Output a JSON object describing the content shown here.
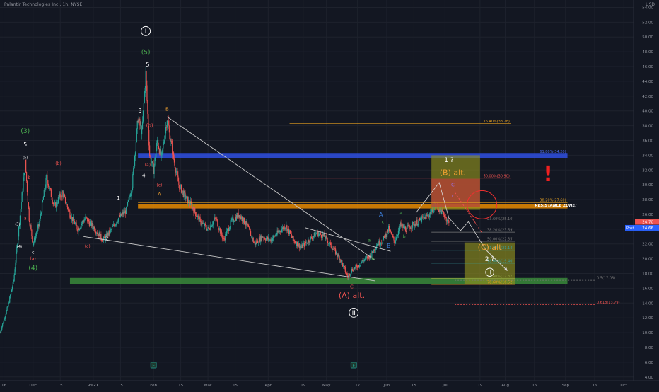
{
  "header": {
    "title": "Palantir Technologies Inc., 1h, NYSE",
    "currency": "USD"
  },
  "colors": {
    "background": "#131722",
    "grid": "#1e222d",
    "up": "#26a69a",
    "down": "#ef5350",
    "blue_zone": "#2f4fe0",
    "orange_zone": "#e68a00",
    "green_zone": "#3a8a3a",
    "yellow_box": "#8f8f1e",
    "red_box": "#c43a3a"
  },
  "chart_data": {
    "type": "candlestick",
    "ylim": [
      3.5,
      55
    ],
    "y_ticks": [
      4,
      6,
      8,
      10,
      12,
      14,
      16,
      18,
      20,
      22,
      24,
      26,
      28,
      30,
      32,
      34,
      36,
      38,
      40,
      42,
      44,
      46,
      48,
      50,
      52,
      54
    ],
    "y_tick_labels": [
      "4.00",
      "6.00",
      "8.00",
      "10.00",
      "12.00",
      "14.00",
      "16.00",
      "18.00",
      "20.00",
      "22.00",
      "24.00",
      "26.00",
      "28.00",
      "30.00",
      "32.00",
      "34.00",
      "36.00",
      "38.00",
      "40.00",
      "42.00",
      "44.00",
      "46.00",
      "48.00",
      "50.00",
      "52.00",
      "54.00"
    ],
    "x_ticks": [
      {
        "label": "16",
        "date": "2020-11-16"
      },
      {
        "label": "Dec",
        "date": "2020-12-01"
      },
      {
        "label": "15",
        "date": "2020-12-15"
      },
      {
        "label": "2021",
        "date": "2021-01-01"
      },
      {
        "label": "15",
        "date": "2021-01-15"
      },
      {
        "label": "Feb",
        "date": "2021-02-01"
      },
      {
        "label": "15",
        "date": "2021-02-15"
      },
      {
        "label": "Mar",
        "date": "2021-03-01"
      },
      {
        "label": "15",
        "date": "2021-03-15"
      },
      {
        "label": "Apr",
        "date": "2021-04-01"
      },
      {
        "label": "19",
        "date": "2021-04-19"
      },
      {
        "label": "May",
        "date": "2021-05-01"
      },
      {
        "label": "17",
        "date": "2021-05-17"
      },
      {
        "label": "Jun",
        "date": "2021-06-01"
      },
      {
        "label": "15",
        "date": "2021-06-15"
      },
      {
        "label": "Jul",
        "date": "2021-07-01"
      },
      {
        "label": "19",
        "date": "2021-07-19"
      },
      {
        "label": "Aug",
        "date": "2021-08-01"
      },
      {
        "label": "16",
        "date": "2021-08-16"
      },
      {
        "label": "Sep",
        "date": "2021-09-01"
      },
      {
        "label": "16",
        "date": "2021-09-16"
      },
      {
        "label": "Oct",
        "date": "2021-10-01"
      }
    ],
    "price_path": [
      {
        "date": "2020-11-14",
        "value": 10.0
      },
      {
        "date": "2020-11-18",
        "value": 13.5
      },
      {
        "date": "2020-11-21",
        "value": 17.0
      },
      {
        "date": "2020-11-24",
        "value": 25.0
      },
      {
        "date": "2020-11-27",
        "value": 33.0
      },
      {
        "date": "2020-11-29",
        "value": 25.5
      },
      {
        "date": "2020-12-01",
        "value": 22.0
      },
      {
        "date": "2020-12-04",
        "value": 24.5
      },
      {
        "date": "2020-12-08",
        "value": 31.0
      },
      {
        "date": "2020-12-12",
        "value": 27.0
      },
      {
        "date": "2020-12-16",
        "value": 29.0
      },
      {
        "date": "2020-12-20",
        "value": 26.0
      },
      {
        "date": "2020-12-24",
        "value": 24.0
      },
      {
        "date": "2020-12-28",
        "value": 25.5
      },
      {
        "date": "2021-01-02",
        "value": 24.0
      },
      {
        "date": "2021-01-06",
        "value": 22.5
      },
      {
        "date": "2021-01-10",
        "value": 23.8
      },
      {
        "date": "2021-01-14",
        "value": 25.5
      },
      {
        "date": "2021-01-18",
        "value": 26.5
      },
      {
        "date": "2021-01-21",
        "value": 30.0
      },
      {
        "date": "2021-01-24",
        "value": 39.0
      },
      {
        "date": "2021-01-26",
        "value": 37.0
      },
      {
        "date": "2021-01-28",
        "value": 45.0
      },
      {
        "date": "2021-01-30",
        "value": 34.0
      },
      {
        "date": "2021-02-01",
        "value": 32.0
      },
      {
        "date": "2021-02-03",
        "value": 36.0
      },
      {
        "date": "2021-02-05",
        "value": 33.5
      },
      {
        "date": "2021-02-08",
        "value": 39.0
      },
      {
        "date": "2021-02-11",
        "value": 34.0
      },
      {
        "date": "2021-02-14",
        "value": 30.0
      },
      {
        "date": "2021-02-17",
        "value": 28.5
      },
      {
        "date": "2021-02-21",
        "value": 27.0
      },
      {
        "date": "2021-02-25",
        "value": 25.0
      },
      {
        "date": "2021-03-01",
        "value": 24.0
      },
      {
        "date": "2021-03-05",
        "value": 25.5
      },
      {
        "date": "2021-03-09",
        "value": 22.5
      },
      {
        "date": "2021-03-13",
        "value": 25.0
      },
      {
        "date": "2021-03-17",
        "value": 26.0
      },
      {
        "date": "2021-03-21",
        "value": 24.5
      },
      {
        "date": "2021-03-25",
        "value": 22.0
      },
      {
        "date": "2021-03-29",
        "value": 23.0
      },
      {
        "date": "2021-04-02",
        "value": 22.5
      },
      {
        "date": "2021-04-06",
        "value": 23.5
      },
      {
        "date": "2021-04-10",
        "value": 24.5
      },
      {
        "date": "2021-04-14",
        "value": 22.5
      },
      {
        "date": "2021-04-18",
        "value": 21.5
      },
      {
        "date": "2021-04-22",
        "value": 22.5
      },
      {
        "date": "2021-04-26",
        "value": 23.5
      },
      {
        "date": "2021-04-30",
        "value": 23.0
      },
      {
        "date": "2021-05-04",
        "value": 21.5
      },
      {
        "date": "2021-05-08",
        "value": 20.0
      },
      {
        "date": "2021-05-12",
        "value": 17.5
      },
      {
        "date": "2021-05-14",
        "value": 18.5
      },
      {
        "date": "2021-05-17",
        "value": 19.0
      },
      {
        "date": "2021-05-20",
        "value": 19.8
      },
      {
        "date": "2021-05-24",
        "value": 20.5
      },
      {
        "date": "2021-05-27",
        "value": 22.0
      },
      {
        "date": "2021-05-30",
        "value": 22.5
      },
      {
        "date": "2021-06-02",
        "value": 24.0
      },
      {
        "date": "2021-06-05",
        "value": 22.3
      },
      {
        "date": "2021-06-08",
        "value": 24.5
      },
      {
        "date": "2021-06-11",
        "value": 24.0
      },
      {
        "date": "2021-06-14",
        "value": 24.5
      },
      {
        "date": "2021-06-17",
        "value": 25.0
      },
      {
        "date": "2021-06-20",
        "value": 25.5
      },
      {
        "date": "2021-06-23",
        "value": 26.0
      },
      {
        "date": "2021-06-26",
        "value": 27.2
      },
      {
        "date": "2021-06-29",
        "value": 26.5
      },
      {
        "date": "2021-07-01",
        "value": 25.8
      },
      {
        "date": "2021-07-03",
        "value": 24.7
      }
    ],
    "zones": [
      {
        "name": "blue-zone",
        "y0": 33.6,
        "y1": 34.3,
        "x0": "2021-01-24",
        "x1": "2021-09-02",
        "color": "#2f4fe0"
      },
      {
        "name": "orange-zone",
        "y0": 26.8,
        "y1": 27.4,
        "x0": "2021-01-24",
        "x1": "2021-09-02",
        "color": "#e68a00"
      },
      {
        "name": "green-zone",
        "y0": 16.6,
        "y1": 17.4,
        "x0": "2020-12-20",
        "x1": "2021-09-02",
        "color": "#3a8a3a"
      }
    ],
    "boxes": [
      {
        "name": "b-alt-yellow-box",
        "x0": "2021-06-24",
        "x1": "2021-07-19",
        "y0": 26.6,
        "y1": 34.0,
        "color": "#8f8f1e"
      },
      {
        "name": "b-alt-red-box",
        "x0": "2021-06-24",
        "x1": "2021-07-19",
        "y0": 27.0,
        "y1": 30.8,
        "color": "#c43a3a"
      },
      {
        "name": "c-alt-yellow-box",
        "x0": "2021-07-11",
        "x1": "2021-08-06",
        "y0": 16.6,
        "y1": 22.2,
        "color": "#8f8f1e"
      }
    ],
    "fib_lines": [
      {
        "label": "76.40%(38.28)",
        "value": 38.28,
        "x0": "2021-04-12",
        "x1": "2021-08-04",
        "color": "#e6a020"
      },
      {
        "label": "61.80%(34.20)",
        "value": 34.2,
        "x0": "2021-01-24",
        "x1": "2021-09-02",
        "color": "#4c6cf0"
      },
      {
        "label": "50.00%(30.90)",
        "value": 30.9,
        "x0": "2021-04-12",
        "x1": "2021-08-04",
        "color": "#ef5350"
      },
      {
        "label": "38.20%(27.60)",
        "value": 27.6,
        "x0": "2021-01-24",
        "x1": "2021-09-02",
        "color": "#e6a020"
      },
      {
        "label": "23.60%(25.10)",
        "value": 25.1,
        "x0": "2021-06-24",
        "x1": "2021-08-06",
        "color": "#7a7a7a"
      },
      {
        "label": "38.20%(23.59)",
        "value": 23.59,
        "x0": "2021-06-24",
        "x1": "2021-08-06",
        "color": "#7a7a7a"
      },
      {
        "label": "50.00%(22.35)",
        "value": 22.35,
        "x0": "2021-06-24",
        "x1": "2021-08-06",
        "color": "#7a7a7a"
      },
      {
        "label": "61.80%(21.14)",
        "value": 21.14,
        "x0": "2021-06-24",
        "x1": "2021-08-06",
        "color": "#3aa0a0"
      },
      {
        "label": "78.60%(19.40)",
        "value": 19.4,
        "x0": "2021-06-24",
        "x1": "2021-08-06",
        "color": "#3aa0a0"
      },
      {
        "label": "76.40%(17.32)",
        "value": 17.32,
        "x0": "2021-06-24",
        "x1": "2021-08-06",
        "color": "#8fa040"
      },
      {
        "label": "78.60%(16.52)",
        "value": 16.52,
        "x0": "2021-06-24",
        "x1": "2021-08-06",
        "color": "#e6a020"
      },
      {
        "label": "0.5(17.08)",
        "value": 17.08,
        "x0": "2021-07-06",
        "x1": "2021-09-16",
        "color": "#7a7a7a"
      },
      {
        "label": "0.618(13.79)",
        "value": 13.79,
        "x0": "2021-07-06",
        "x1": "2021-09-16",
        "color": "#ef5350"
      }
    ],
    "trendlines": [
      {
        "name": "upper-wedge-line",
        "x0": "2021-02-08",
        "y0": 39.2,
        "x1": "2021-05-26",
        "y1": 19.8,
        "color": "#c8c8c8"
      },
      {
        "name": "lower-wedge-line",
        "x0": "2020-12-27",
        "y0": 23.0,
        "x1": "2021-05-26",
        "y1": 17.0,
        "color": "#c8c8c8"
      },
      {
        "name": "breakout-line",
        "x0": "2021-04-20",
        "y0": 24.2,
        "x1": "2021-06-03",
        "y1": 21.0,
        "color": "#c8c8c8"
      }
    ],
    "projection": [
      {
        "date": "2021-06-16",
        "value": 26.2
      },
      {
        "date": "2021-06-28",
        "value": 30.3
      },
      {
        "date": "2021-07-03",
        "value": 25.5
      },
      {
        "date": "2021-07-09",
        "value": 23.8
      },
      {
        "date": "2021-07-13",
        "value": 25.0
      },
      {
        "date": "2021-07-22",
        "value": 21.2
      },
      {
        "date": "2021-08-02",
        "value": 18.4
      }
    ],
    "red_dashed": [
      {
        "date": "2021-07-06",
        "value": 29.0
      },
      {
        "date": "2021-07-20",
        "value": 23.5
      }
    ],
    "resistance_ellipse": {
      "date": "2021-07-20",
      "value": 27.3
    },
    "wave_labels": [
      {
        "text": "I",
        "circled": true,
        "date": "2021-01-28",
        "value": 50.5,
        "color": "#ffffff",
        "size": 9
      },
      {
        "text": "(5)",
        "date": "2021-01-28",
        "value": 47.7,
        "color": "#4caf50",
        "size": 9
      },
      {
        "text": "5",
        "date": "2021-01-29",
        "value": 46.0,
        "color": "#ffffff",
        "size": 8
      },
      {
        "text": "3",
        "date": "2021-01-25",
        "value": 39.8,
        "color": "#ffffff",
        "size": 8
      },
      {
        "text": "(b)",
        "date": "2021-01-30",
        "value": 37.8,
        "color": "#ef5350",
        "size": 7
      },
      {
        "text": "B",
        "date": "2021-02-08",
        "value": 40.0,
        "color": "#f0a030",
        "size": 7
      },
      {
        "text": "(a)",
        "date": "2021-01-29",
        "value": 32.5,
        "color": "#ef5350",
        "size": 6
      },
      {
        "text": "4",
        "date": "2021-01-27",
        "value": 31.0,
        "color": "#ffffff",
        "size": 7
      },
      {
        "text": "(c)",
        "date": "2021-02-04",
        "value": 29.8,
        "color": "#ef5350",
        "size": 6
      },
      {
        "text": "A",
        "date": "2021-02-04",
        "value": 28.5,
        "color": "#f0a030",
        "size": 7
      },
      {
        "text": "1",
        "date": "2021-01-14",
        "value": 28.0,
        "color": "#ffffff",
        "size": 7
      },
      {
        "text": "2",
        "date": "2021-01-08",
        "value": 22.5,
        "color": "#ffffff",
        "size": 7
      },
      {
        "text": "(3)",
        "date": "2020-11-27",
        "value": 37.0,
        "color": "#4caf50",
        "size": 9
      },
      {
        "text": "5",
        "date": "2020-11-27",
        "value": 35.2,
        "color": "#ffffff",
        "size": 8
      },
      {
        "text": "(5)",
        "date": "2020-11-27",
        "value": 33.5,
        "color": "#ffffff",
        "size": 5
      },
      {
        "text": "(b)",
        "date": "2020-12-14",
        "value": 32.7,
        "color": "#ef5350",
        "size": 6
      },
      {
        "text": "b",
        "date": "2020-11-29",
        "value": 30.8,
        "color": "#ef5350",
        "size": 6
      },
      {
        "text": "a",
        "date": "2020-11-27",
        "value": 25.3,
        "color": "#ef5350",
        "size": 6
      },
      {
        "text": "(3)",
        "date": "2020-11-23",
        "value": 24.5,
        "color": "#ffffff",
        "size": 5
      },
      {
        "text": "(4)",
        "date": "2020-11-24",
        "value": 21.5,
        "color": "#ffffff",
        "size": 5
      },
      {
        "text": "c",
        "date": "2020-12-01",
        "value": 20.7,
        "color": "#ffffff",
        "size": 6
      },
      {
        "text": "(a)",
        "date": "2020-12-01",
        "value": 19.8,
        "color": "#ef5350",
        "size": 6
      },
      {
        "text": "(4)",
        "date": "2020-12-01",
        "value": 18.5,
        "color": "#4caf50",
        "size": 9
      },
      {
        "text": "(c)",
        "date": "2020-12-29",
        "value": 21.5,
        "color": "#ef5350",
        "size": 6
      },
      {
        "text": "A",
        "date": "2021-05-29",
        "value": 25.7,
        "color": "#3a7bd5",
        "size": 8
      },
      {
        "text": "c",
        "date": "2021-05-30",
        "value": 24.8,
        "color": "#4caf50",
        "size": 6
      },
      {
        "text": "a",
        "date": "2021-06-08",
        "value": 26.0,
        "color": "#4caf50",
        "size": 6
      },
      {
        "text": "b",
        "date": "2021-06-10",
        "value": 22.8,
        "color": "#4caf50",
        "size": 6
      },
      {
        "text": "a",
        "date": "2021-05-23",
        "value": 22.3,
        "color": "#4caf50",
        "size": 6
      },
      {
        "text": "b",
        "date": "2021-05-25",
        "value": 19.8,
        "color": "#4caf50",
        "size": 6
      },
      {
        "text": "B",
        "date": "2021-06-02",
        "value": 21.5,
        "color": "#3a7bd5",
        "size": 8
      },
      {
        "text": "C",
        "date": "2021-05-14",
        "value": 16.0,
        "color": "#ef5350",
        "size": 7
      },
      {
        "text": "(A) alt.",
        "date": "2021-05-14",
        "value": 14.7,
        "color": "#ef5350",
        "size": 11
      },
      {
        "text": "II",
        "circled": true,
        "date": "2021-05-15",
        "value": 12.4,
        "color": "#ffffff",
        "size": 9
      },
      {
        "text": "1 ?",
        "date": "2021-07-03",
        "value": 33.1,
        "color": "#ffffff",
        "size": 9
      },
      {
        "text": "(B) alt.",
        "date": "2021-07-05",
        "value": 31.3,
        "color": "#f0a030",
        "size": 11
      },
      {
        "text": "C",
        "date": "2021-07-05",
        "value": 29.8,
        "color": "#9c6cd0",
        "size": 7
      },
      {
        "text": "c",
        "date": "2021-07-05",
        "value": 28.3,
        "color": "#9c6cd0",
        "size": 6
      },
      {
        "text": "(C) alt",
        "date": "2021-07-24",
        "value": 21.2,
        "color": "#f0a030",
        "size": 11
      },
      {
        "text": "2 ?",
        "date": "2021-07-24",
        "value": 19.7,
        "color": "#ffffff",
        "size": 9
      },
      {
        "text": "II",
        "circled": true,
        "date": "2021-07-24",
        "value": 17.9,
        "color": "#ffffff",
        "size": 8
      },
      {
        "text": "!",
        "date": "2021-08-23",
        "value": 30.5,
        "color": "#ef2020",
        "size": 30,
        "bold": true
      }
    ],
    "resistance_label": "RESISTANCE ZONE!",
    "last_price": {
      "value": 24.7,
      "label": "24.70"
    },
    "post_price": {
      "value": 24.66,
      "label": "24.66",
      "tag": "Post"
    },
    "event_markers": [
      {
        "date": "2021-02-01",
        "text": "E"
      },
      {
        "date": "2021-05-15",
        "text": "E"
      }
    ]
  }
}
